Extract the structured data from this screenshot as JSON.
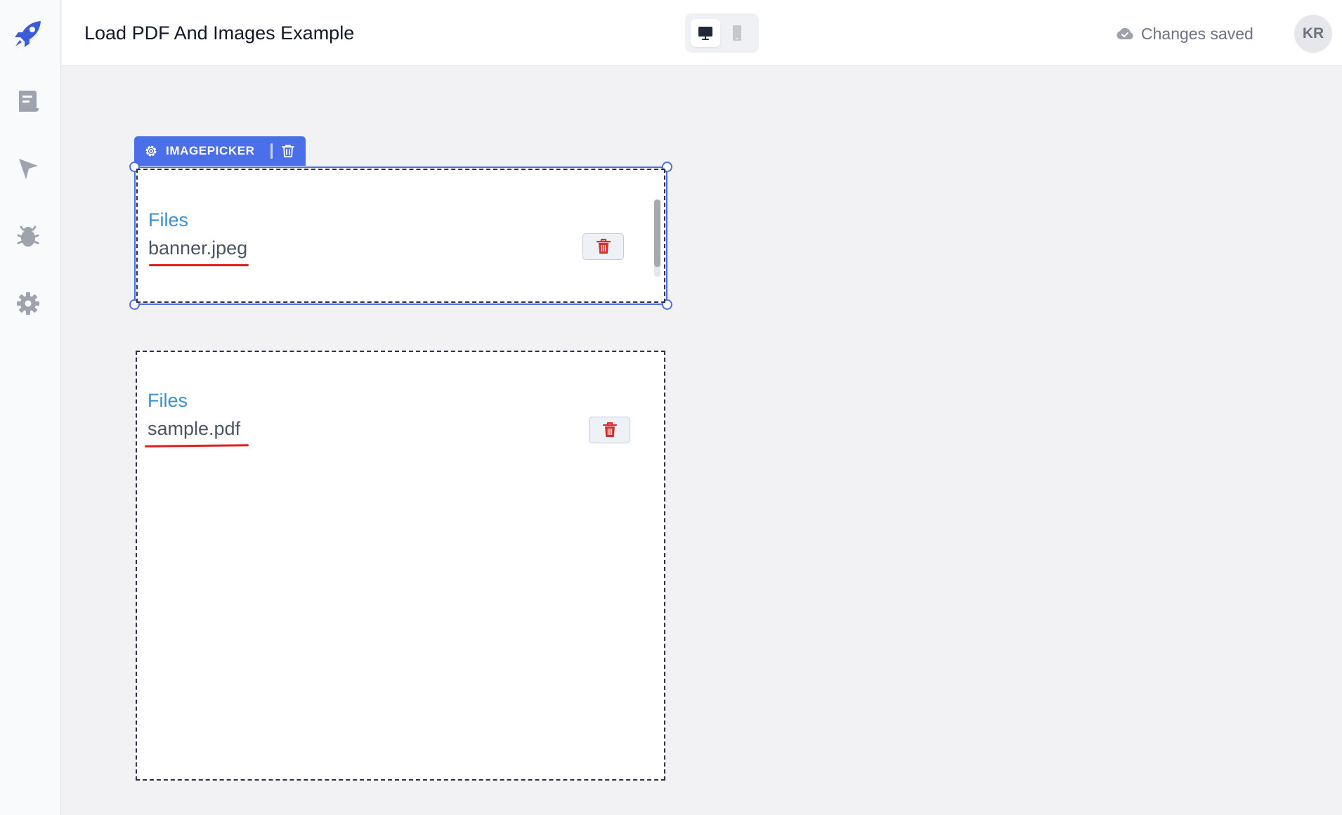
{
  "sidebar": {
    "logo_icon": "rocket-icon",
    "items": [
      {
        "icon": "editor-document-icon"
      },
      {
        "icon": "send-arrow-icon"
      },
      {
        "icon": "bug-icon"
      },
      {
        "icon": "gear-icon"
      }
    ]
  },
  "header": {
    "title_value": "Load PDF And Images Example",
    "device_toggle": {
      "active": "desktop",
      "options": [
        "desktop",
        "mobile"
      ]
    },
    "save_status": "Changes saved",
    "avatar_initials": "KR"
  },
  "canvas": {
    "selected_toolbar": {
      "label": "IMAGEPICKER",
      "settings_icon": "gear-icon",
      "delete_icon": "trash-icon"
    },
    "widgets": [
      {
        "label": "Files",
        "file_name": "banner.jpeg",
        "delete_icon": "trash-icon"
      },
      {
        "label": "Files",
        "file_name": "sample.pdf",
        "delete_icon": "trash-icon"
      }
    ]
  },
  "colors": {
    "accent": "#4b6fe8",
    "files_label": "#3b8fd1",
    "underline": "#e11d1d",
    "delete_icon": "#d32f2f"
  }
}
